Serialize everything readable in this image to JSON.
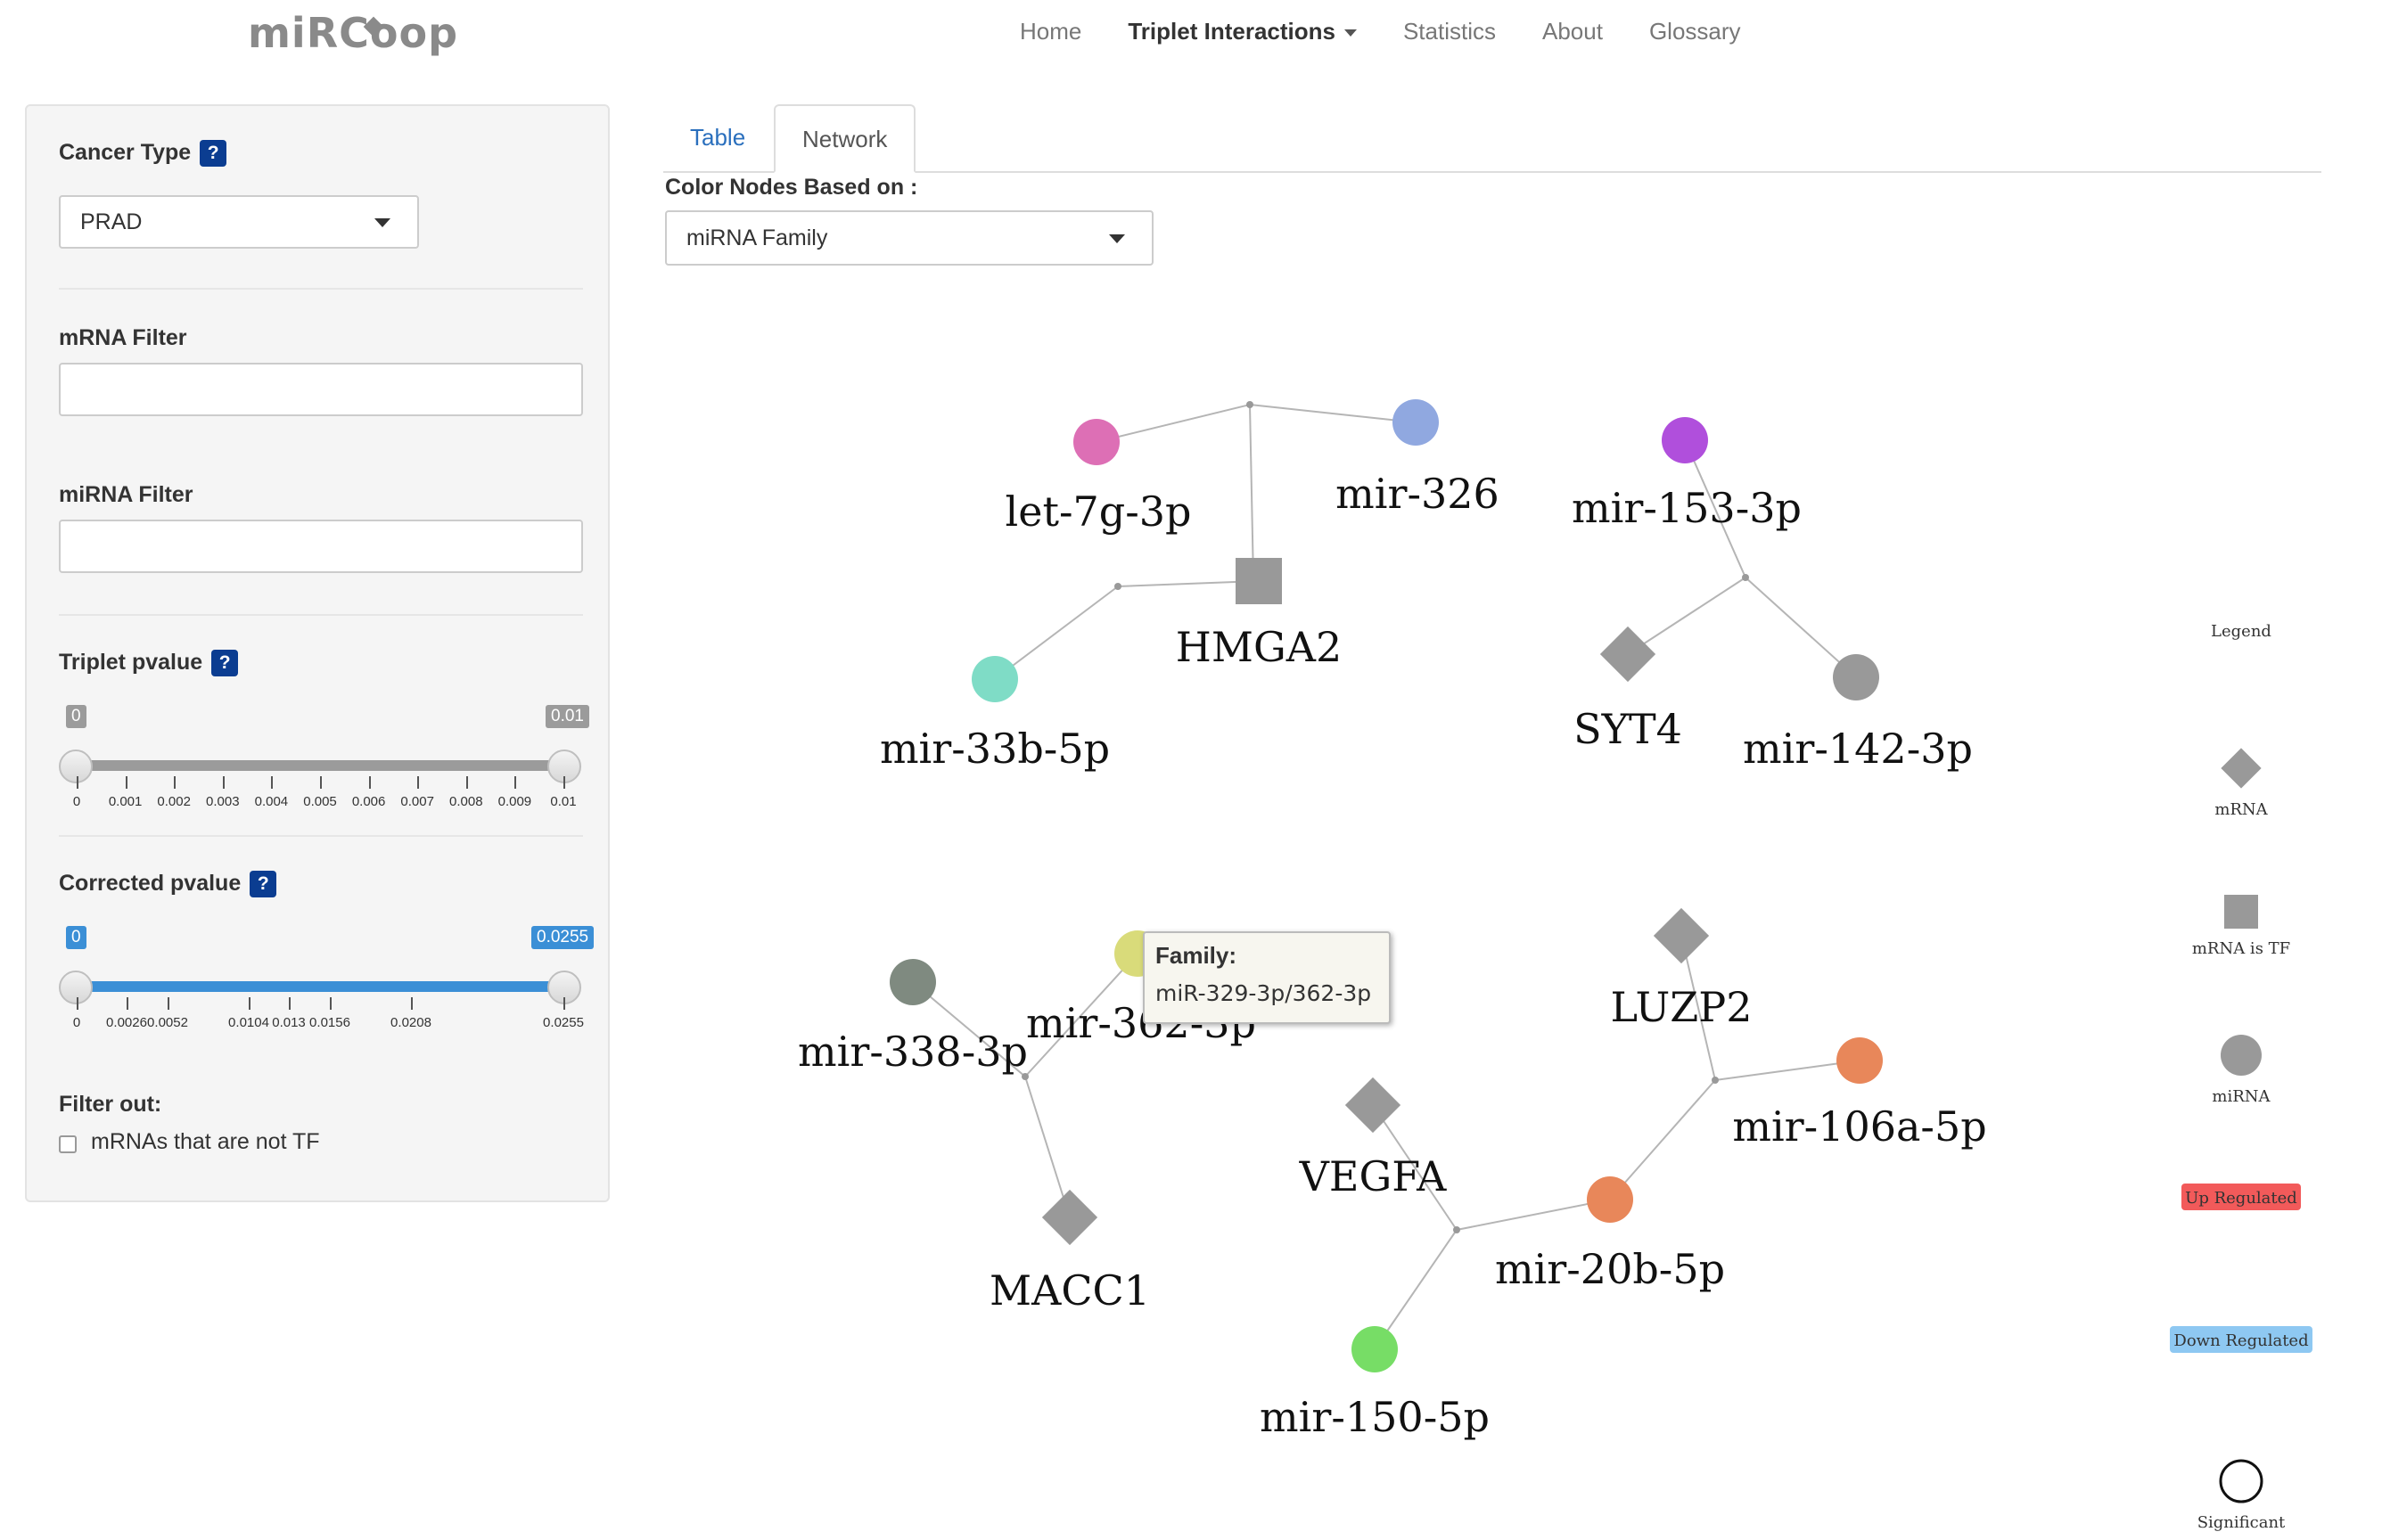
{
  "app": {
    "logo": "miRCoop"
  },
  "nav": [
    "Home",
    "Triplet Interactions",
    "Statistics",
    "About",
    "Glossary"
  ],
  "sidebar": {
    "cancer_type_label": "Cancer Type",
    "cancer_type_value": "PRAD",
    "mrna_filter_label": "mRNA Filter",
    "mirna_filter_label": "miRNA Filter",
    "triplet_pvalue_label": "Triplet pvalue",
    "triplet_slider": {
      "min": "0",
      "max": "0.01",
      "value_low": "0",
      "value_high": "0.01",
      "ticks": [
        "0",
        "0.001",
        "0.002",
        "0.003",
        "0.004",
        "0.005",
        "0.006",
        "0.007",
        "0.008",
        "0.009",
        "0.01"
      ]
    },
    "corrected_pvalue_label": "Corrected pvalue",
    "corrected_slider": {
      "min": "0",
      "max": "0.0255",
      "value_low": "0",
      "value_high": "0.0255",
      "ticks": [
        "0",
        "0.0026",
        "0.0052",
        "0.0104",
        "0.013",
        "0.0156",
        "0.0208",
        "0.0255"
      ]
    },
    "filter_out_label": "Filter out:",
    "filter_checkbox_label": "mRNAs that are not TF",
    "help_mark": "?"
  },
  "tabs": {
    "table": "Table",
    "network": "Network"
  },
  "color_nodes_label": "Color Nodes Based on :",
  "color_nodes_value": "miRNA Family",
  "network": {
    "nodes": [
      {
        "id": "let7g",
        "label": "let-7g-3p",
        "type": "mirna",
        "color": "#dd6fb5"
      },
      {
        "id": "mir326",
        "label": "mir-326",
        "type": "mirna",
        "color": "#90a8e0"
      },
      {
        "id": "hmga2",
        "label": "HMGA2",
        "type": "tf",
        "color": "#999999"
      },
      {
        "id": "mir33b",
        "label": "mir-33b-5p",
        "type": "mirna",
        "color": "#7fdcc6"
      },
      {
        "id": "mir153",
        "label": "mir-153-3p",
        "type": "mirna",
        "color": "#b04fdc"
      },
      {
        "id": "syt4",
        "label": "SYT4",
        "type": "mrna",
        "color": "#999999"
      },
      {
        "id": "mir142",
        "label": "mir-142-3p",
        "type": "mirna",
        "color": "#999999"
      },
      {
        "id": "mir338",
        "label": "mir-338-3p",
        "type": "mirna",
        "color": "#7f8a80"
      },
      {
        "id": "mir362",
        "label": "mir-362-3p",
        "type": "mirna",
        "color": "#d9db7a"
      },
      {
        "id": "macc1",
        "label": "MACC1",
        "type": "mrna",
        "color": "#999999"
      },
      {
        "id": "luzp2",
        "label": "LUZP2",
        "type": "mrna",
        "color": "#999999"
      },
      {
        "id": "mir106a",
        "label": "mir-106a-5p",
        "type": "mirna",
        "color": "#e8875a"
      },
      {
        "id": "vegfa",
        "label": "VEGFA",
        "type": "mrna",
        "color": "#999999"
      },
      {
        "id": "mir20b",
        "label": "mir-20b-5p",
        "type": "mirna",
        "color": "#e8875a"
      },
      {
        "id": "mir150",
        "label": "mir-150-5p",
        "type": "mirna",
        "color": "#77dd66"
      }
    ]
  },
  "tooltip": {
    "title": "Family:",
    "value": "miR-329-3p/362-3p"
  },
  "legend": {
    "title": "Legend",
    "mrna": "mRNA",
    "mrna_tf": "mRNA is TF",
    "mirna": "miRNA",
    "up": "Up Regulated",
    "down": "Down Regulated",
    "significant": "Significant",
    "up_color": "#f25a5a",
    "down_color": "#8ec8f2"
  }
}
